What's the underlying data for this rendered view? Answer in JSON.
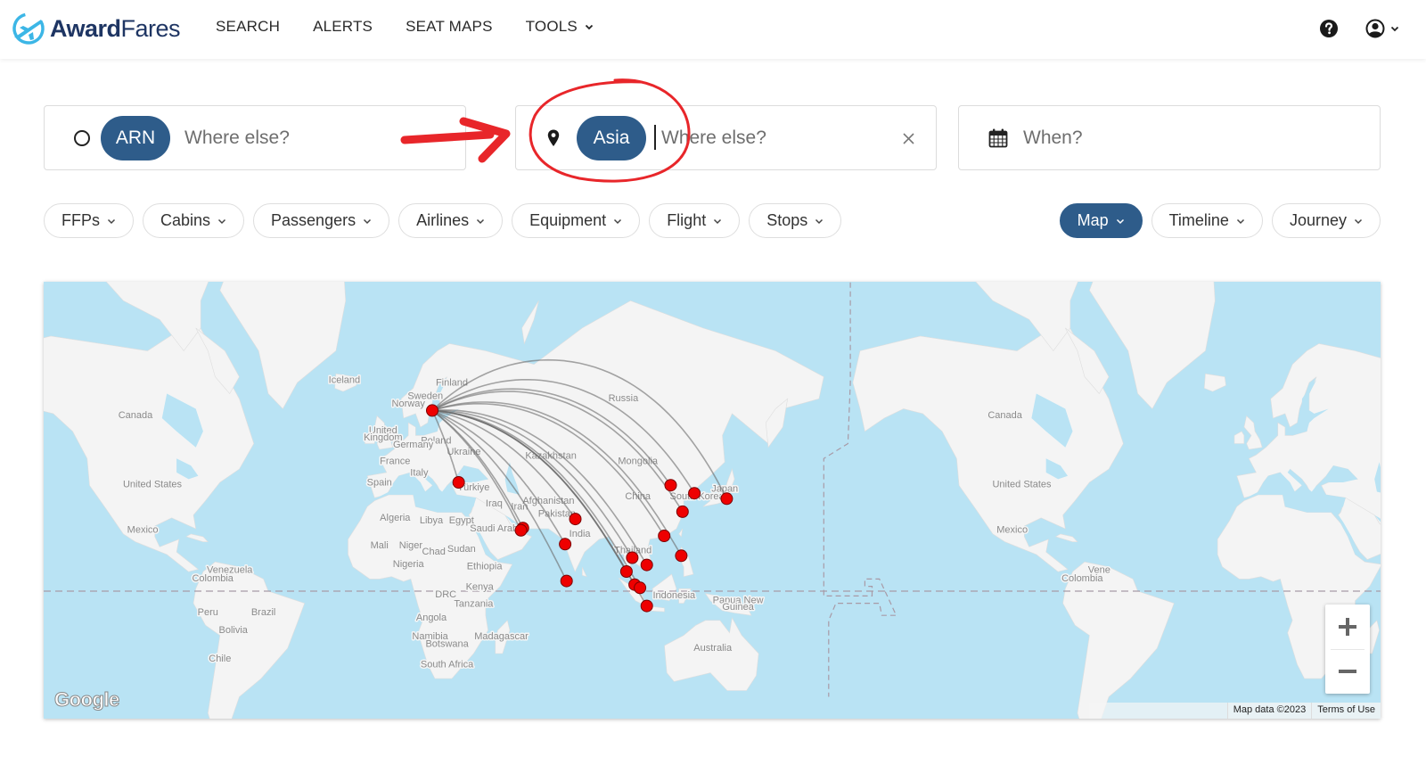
{
  "header": {
    "logo_bold": "Award",
    "logo_light": "Fares",
    "nav": [
      {
        "label": "SEARCH",
        "has_dropdown": false
      },
      {
        "label": "ALERTS",
        "has_dropdown": false
      },
      {
        "label": "SEAT MAPS",
        "has_dropdown": false
      },
      {
        "label": "TOOLS",
        "has_dropdown": true
      }
    ],
    "icons": {
      "help": "question-circle-icon",
      "user": "user-circle-icon"
    }
  },
  "search": {
    "origin": {
      "icon": "circle-icon",
      "chip": "ARN",
      "placeholder": "Where else?"
    },
    "destination": {
      "icon": "map-pin-icon",
      "chip": "Asia",
      "placeholder": "Where else?",
      "clear_icon": "close-icon"
    },
    "when": {
      "icon": "calendar-icon",
      "placeholder": "When?"
    }
  },
  "filters": [
    {
      "label": "FFPs"
    },
    {
      "label": "Cabins"
    },
    {
      "label": "Passengers"
    },
    {
      "label": "Airlines"
    },
    {
      "label": "Equipment"
    },
    {
      "label": "Flight"
    },
    {
      "label": "Stops"
    }
  ],
  "views": [
    {
      "label": "Map",
      "active": true
    },
    {
      "label": "Timeline",
      "active": false
    },
    {
      "label": "Journey",
      "active": false
    }
  ],
  "map": {
    "origin": {
      "name": "Stockholm (ARN)",
      "lat": 59.65,
      "lon": 17.9
    },
    "destinations": [
      {
        "name": "Istanbul",
        "lat": 41.0,
        "lon": 28.8
      },
      {
        "name": "Dubai",
        "lat": 25.25,
        "lon": 55.4
      },
      {
        "name": "Abu Dhabi",
        "lat": 24.4,
        "lon": 54.6
      },
      {
        "name": "Delhi",
        "lat": 28.6,
        "lon": 77.1
      },
      {
        "name": "Mumbai",
        "lat": 19.1,
        "lon": 72.9
      },
      {
        "name": "Male",
        "lat": 4.2,
        "lon": 73.5
      },
      {
        "name": "Bangkok",
        "lat": 13.7,
        "lon": 100.7
      },
      {
        "name": "Phuket",
        "lat": 8.1,
        "lon": 98.3
      },
      {
        "name": "Ho Chi Minh City",
        "lat": 10.8,
        "lon": 106.7
      },
      {
        "name": "Kuala Lumpur",
        "lat": 2.7,
        "lon": 101.7
      },
      {
        "name": "Singapore",
        "lat": 1.35,
        "lon": 103.9
      },
      {
        "name": "Jakarta",
        "lat": -6.1,
        "lon": 106.7
      },
      {
        "name": "Manila",
        "lat": 14.5,
        "lon": 121.0
      },
      {
        "name": "Hong Kong",
        "lat": 22.3,
        "lon": 113.9
      },
      {
        "name": "Shanghai",
        "lat": 31.2,
        "lon": 121.5
      },
      {
        "name": "Beijing",
        "lat": 40.1,
        "lon": 116.6
      },
      {
        "name": "Seoul",
        "lat": 37.5,
        "lon": 126.4
      },
      {
        "name": "Tokyo",
        "lat": 35.7,
        "lon": 139.8
      }
    ],
    "labels": [
      {
        "text": "Finland",
        "lat": 64.5,
        "lon": 26.0
      },
      {
        "text": "Sweden",
        "lat": 62.0,
        "lon": 15.0
      },
      {
        "text": "Norway",
        "lat": 60.5,
        "lon": 8.0
      },
      {
        "text": "Iceland",
        "lat": 64.9,
        "lon": -18.5
      },
      {
        "text": "United",
        "lat": 54.5,
        "lon": -2.5
      },
      {
        "text": "Kingdom",
        "lat": 52.8,
        "lon": -2.5
      },
      {
        "text": "Poland",
        "lat": 52.0,
        "lon": 19.5
      },
      {
        "text": "Germany",
        "lat": 51.0,
        "lon": 10.0
      },
      {
        "text": "Ukraine",
        "lat": 49.0,
        "lon": 31.0
      },
      {
        "text": "France",
        "lat": 46.5,
        "lon": 2.5
      },
      {
        "text": "Italy",
        "lat": 43.0,
        "lon": 12.5
      },
      {
        "text": "Spain",
        "lat": 40.0,
        "lon": -4.0
      },
      {
        "text": "Türkiye",
        "lat": 38.5,
        "lon": 35.0
      },
      {
        "text": "Russia",
        "lat": 61.5,
        "lon": 97.0
      },
      {
        "text": "Kazakhstan",
        "lat": 48.0,
        "lon": 67.0
      },
      {
        "text": "Mongolia",
        "lat": 46.5,
        "lon": 103.0
      },
      {
        "text": "China",
        "lat": 35.5,
        "lon": 103.0
      },
      {
        "text": "South Korea",
        "lat": 35.5,
        "lon": 127.5
      },
      {
        "text": "Japan",
        "lat": 38.0,
        "lon": 139.0
      },
      {
        "text": "Iraq",
        "lat": 33.0,
        "lon": 43.5
      },
      {
        "text": "Iran",
        "lat": 32.0,
        "lon": 54.0
      },
      {
        "text": "Afghanistan",
        "lat": 34.0,
        "lon": 66.0
      },
      {
        "text": "Pakistan",
        "lat": 29.5,
        "lon": 69.5
      },
      {
        "text": "India",
        "lat": 22.0,
        "lon": 79.0
      },
      {
        "text": "Thailand",
        "lat": 15.5,
        "lon": 101.0
      },
      {
        "text": "Egypt",
        "lat": 27.0,
        "lon": 30.0
      },
      {
        "text": "Saudi Arabia",
        "lat": 24.0,
        "lon": 45.0
      },
      {
        "text": "Algeria",
        "lat": 28.0,
        "lon": 2.5
      },
      {
        "text": "Libya",
        "lat": 27.0,
        "lon": 17.5
      },
      {
        "text": "Mali",
        "lat": 17.5,
        "lon": -4.0
      },
      {
        "text": "Niger",
        "lat": 17.5,
        "lon": 9.0
      },
      {
        "text": "Chad",
        "lat": 15.0,
        "lon": 18.5
      },
      {
        "text": "Sudan",
        "lat": 16.0,
        "lon": 30.0
      },
      {
        "text": "Nigeria",
        "lat": 10.0,
        "lon": 8.0
      },
      {
        "text": "Ethiopia",
        "lat": 9.0,
        "lon": 39.5
      },
      {
        "text": "Kenya",
        "lat": 0.5,
        "lon": 37.5
      },
      {
        "text": "DRC",
        "lat": -2.5,
        "lon": 23.5
      },
      {
        "text": "Tanzania",
        "lat": -6.5,
        "lon": 35.0
      },
      {
        "text": "Angola",
        "lat": -12.0,
        "lon": 17.5
      },
      {
        "text": "Namibia",
        "lat": -19.5,
        "lon": 17.0
      },
      {
        "text": "Botswana",
        "lat": -22.5,
        "lon": 24.0
      },
      {
        "text": "Madagascar",
        "lat": -19.5,
        "lon": 46.5
      },
      {
        "text": "South Africa",
        "lat": -30.0,
        "lon": 24.0
      },
      {
        "text": "Indonesia",
        "lat": -3.0,
        "lon": 118.0
      },
      {
        "text": "Papua New",
        "lat": -5.0,
        "lon": 144.5
      },
      {
        "text": "Guinea",
        "lat": -7.8,
        "lon": 144.5
      },
      {
        "text": "Australia",
        "lat": -24.0,
        "lon": 134.0
      },
      {
        "text": "Canada",
        "lat": 58.0,
        "lon": -105.0
      },
      {
        "text": "United States",
        "lat": 39.5,
        "lon": -98.0
      },
      {
        "text": "Mexico",
        "lat": 23.5,
        "lon": -102.0
      },
      {
        "text": "Venezuela",
        "lat": 7.5,
        "lon": -66.0
      },
      {
        "text": "Colombia",
        "lat": 4.0,
        "lon": -73.0
      },
      {
        "text": "Brazil",
        "lat": -10.0,
        "lon": -52.0
      },
      {
        "text": "Peru",
        "lat": -10.0,
        "lon": -75.0
      },
      {
        "text": "Bolivia",
        "lat": -17.0,
        "lon": -64.5
      },
      {
        "text": "Chile",
        "lat": -28.0,
        "lon": -70.0
      },
      {
        "text": "Canada",
        "lat": 58.0,
        "lon": 255.0
      },
      {
        "text": "United States",
        "lat": 39.5,
        "lon": 262.0
      },
      {
        "text": "Mexico",
        "lat": 23.5,
        "lon": 258.0
      },
      {
        "text": "Colombia",
        "lat": 4.0,
        "lon": 287.0
      },
      {
        "text": "Vene",
        "lat": 7.5,
        "lon": 294.0
      }
    ],
    "attribution": "Map data ©2023",
    "terms": "Terms of Use",
    "provider": "Google",
    "zoom_in": "+",
    "zoom_out": "−",
    "colors": {
      "marker": "#ee0000",
      "route": "#6b6b6b",
      "water": "#b9e3f4",
      "land": "#f4f4f4"
    }
  },
  "annotation": {
    "color": "#e8262a",
    "note": "Red arrow and circle highlighting the Asia destination chip"
  }
}
